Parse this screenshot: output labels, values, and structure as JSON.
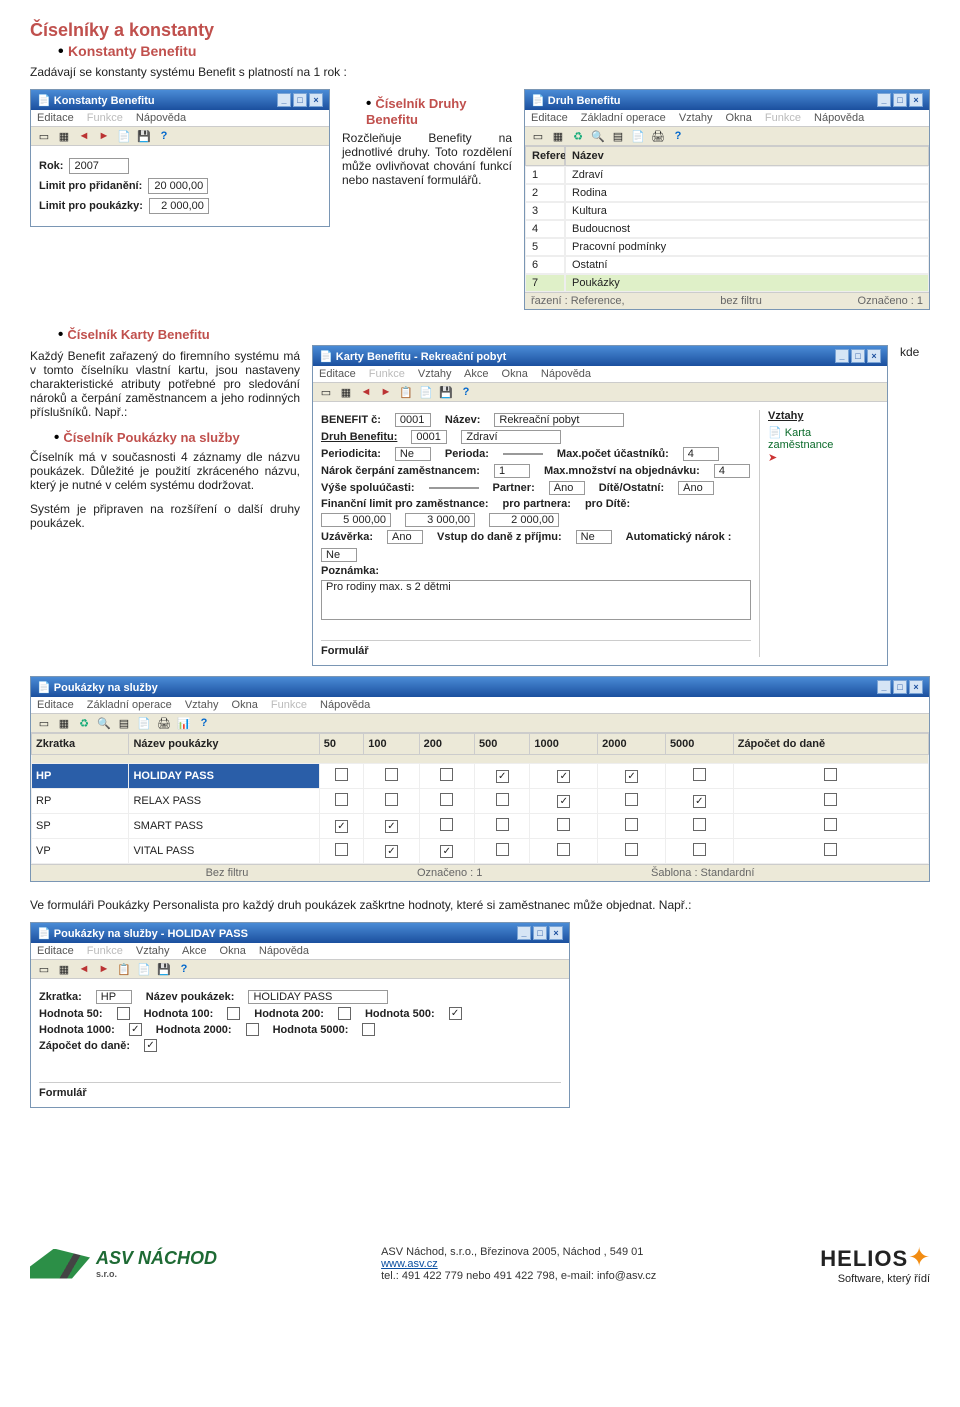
{
  "doc": {
    "h1": "Číselníky a konstanty",
    "h1_sub": "Konstanty Benefitu",
    "p1": "Zadávají se konstanty systému Benefit s platností na 1 rok :",
    "h2": "Číselník Druhy Benefitu",
    "p2": "Rozčleňuje Benefity na jednotlivé druhy. Toto rozdělení může ovlivňovat chování funkcí nebo nastavení formulářů.",
    "h3": "Číselník Karty Benefitu",
    "p3a": "Každý Benefit zařazený do firemního systému má v tomto číselníku vlastní kartu, jsou nastaveny charakteristické atributy potřebné pro sledování nároků a čerpání zaměstnancem a jeho rodinných příslušníků. Např.:",
    "p3_kde": "kde",
    "h4": "Číselník Poukázky na služby",
    "p4": "Číselník má v současnosti 4 záznamy dle názvu poukázek. Důležité je použití zkráceného názvu, který je nutné v celém systému dodržovat.",
    "p4b": "Systém je připraven na rozšíření o další druhy poukázek.",
    "p5": "Ve formuláři Poukázky Personalista pro každý druh poukázek zaškrtne hodnoty, které si zaměstnanec může objednat. Např.:"
  },
  "winKonstanty": {
    "title": "Konstanty Benefitu",
    "menu": [
      "Editace",
      "Funkce",
      "Nápověda"
    ],
    "rok_label": "Rok:",
    "rok": "2007",
    "lim1_label": "Limit pro přidanění:",
    "lim1": "20 000,00",
    "lim2_label": "Limit pro poukázky:",
    "lim2": "2 000,00"
  },
  "winDruh": {
    "title": "Druh Benefitu",
    "menu": [
      "Editace",
      "Základní operace",
      "Vztahy",
      "Okna",
      "Funkce",
      "Nápověda"
    ],
    "col1": "Reference",
    "col2": "Název",
    "rows": [
      {
        "r": "1",
        "n": "Zdraví"
      },
      {
        "r": "2",
        "n": "Rodina"
      },
      {
        "r": "3",
        "n": "Kultura"
      },
      {
        "r": "4",
        "n": "Budoucnost"
      },
      {
        "r": "5",
        "n": "Pracovní podmínky"
      },
      {
        "r": "6",
        "n": "Ostatní"
      },
      {
        "r": "7",
        "n": "Poukázky"
      }
    ],
    "status_l": "řazení : Reference,",
    "status_c": "bez filtru",
    "status_r": "Označeno : 1"
  },
  "winKarty": {
    "title": "Karty Benefitu - Rekreační pobyt",
    "menu": [
      "Editace",
      "Funkce",
      "Vztahy",
      "Akce",
      "Okna",
      "Nápověda"
    ],
    "benefit_c_label": "BENEFIT č:",
    "benefit_c": "0001",
    "nazev_label": "Název:",
    "nazev": "Rekreační pobyt",
    "druh_label": "Druh Benefitu:",
    "druh_c": "0001",
    "druh_t": "Zdraví",
    "periodicita_label": "Periodicita:",
    "periodicita": "Ne",
    "perioda_label": "Perioda:",
    "perioda": "",
    "maxu_label": "Max.počet účastníků:",
    "maxu": "4",
    "narokz_label": "Nárok čerpání zaměstnancem:",
    "narokz": "1",
    "maxo_label": "Max.množství na objednávku:",
    "maxo": "4",
    "vyse_label": "Výše spoluúčasti:",
    "vyse": "",
    "partner_label": "Partner:",
    "partner": "Ano",
    "dite_label": "Dítě/Ostatní:",
    "dite": "Ano",
    "finlim_label": "Finanční limit pro zaměstnance:",
    "proP_label": "pro partnera:",
    "proD_label": "pro Dítě:",
    "lim_z": "5 000,00",
    "lim_p": "3 000,00",
    "lim_d": "2 000,00",
    "uzav_label": "Uzávěrka:",
    "uzav": "Ano",
    "vstup_label": "Vstup do daně z příjmu:",
    "vstup": "Ne",
    "auto_label": "Automatický nárok :",
    "auto": "Ne",
    "pozn_label": "Poznámka:",
    "pozn": "Pro rodiny max. s 2 dětmi",
    "formular": "Formulář",
    "side_h": "Vztahy",
    "side_link": "Karta zaměstnance"
  },
  "winPoukazky": {
    "title": "Poukázky na služby",
    "menu": [
      "Editace",
      "Základní operace",
      "Vztahy",
      "Okna",
      "Funkce",
      "Nápověda"
    ],
    "cols": [
      "Zkratka",
      "Název poukázky",
      "50",
      "100",
      "200",
      "500",
      "1000",
      "2000",
      "5000",
      "Zápočet do daně"
    ],
    "rows": [
      {
        "zk": "HP",
        "n": "HOLIDAY PASS",
        "v": [
          0,
          0,
          0,
          1,
          1,
          1,
          0,
          0
        ]
      },
      {
        "zk": "RP",
        "n": "RELAX PASS",
        "v": [
          0,
          0,
          0,
          0,
          1,
          0,
          1,
          0
        ]
      },
      {
        "zk": "SP",
        "n": "SMART PASS",
        "v": [
          1,
          1,
          0,
          0,
          0,
          0,
          0,
          0
        ]
      },
      {
        "zk": "VP",
        "n": "VITAL PASS",
        "v": [
          0,
          1,
          1,
          0,
          0,
          0,
          0,
          0
        ]
      }
    ],
    "status": [
      "Bez filtru",
      "Označeno : 1",
      "Šablona : Standardní"
    ]
  },
  "winPoukHP": {
    "title": "Poukázky na služby - HOLIDAY PASS",
    "menu": [
      "Editace",
      "Funkce",
      "Vztahy",
      "Akce",
      "Okna",
      "Nápověda"
    ],
    "zk_label": "Zkratka:",
    "zk": "HP",
    "np_label": "Název poukázek:",
    "np": "HOLIDAY PASS",
    "h50": "Hodnota 50:",
    "h100": "Hodnota 100:",
    "h200": "Hodnota 200:",
    "h500": "Hodnota 500:",
    "h1000": "Hodnota 1000:",
    "h2000": "Hodnota 2000:",
    "h5000": "Hodnota 5000:",
    "v": {
      "50": 0,
      "100": 0,
      "200": 0,
      "500": 1,
      "1000": 1,
      "2000": 0,
      "5000": 0
    },
    "zap_label": "Zápočet do daně:",
    "zap": 1,
    "formular": "Formulář"
  },
  "footer": {
    "company": "ASV Náchod, s.r.o., Březinova 2005, Náchod , 549 01",
    "web": "www.asv.cz",
    "tel": "tel.: 491 422 779 nebo 491 422 798, e-mail: info@asv.cz",
    "helios": "HELIOS",
    "helios_sub": "Software, který řídí"
  }
}
